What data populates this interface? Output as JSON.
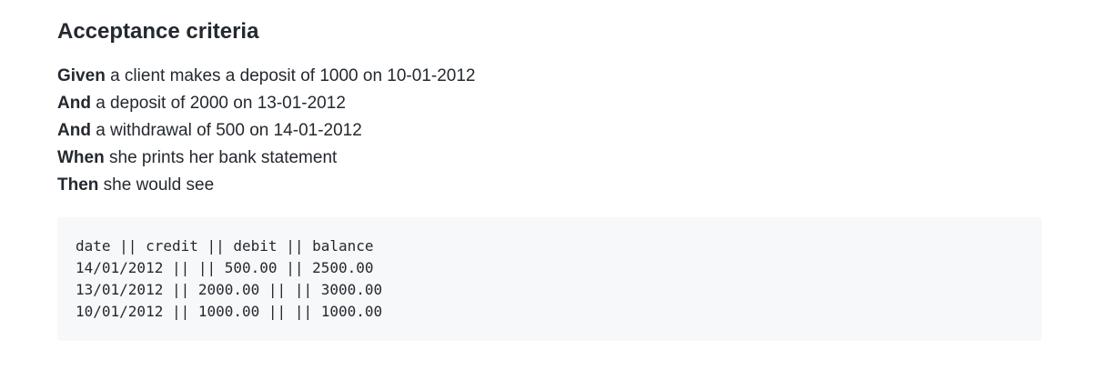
{
  "heading": "Acceptance criteria",
  "criteria": [
    {
      "keyword": "Given",
      "text": " a client makes a deposit of 1000 on 10-01-2012"
    },
    {
      "keyword": "And",
      "text": " a deposit of 2000 on 13-01-2012"
    },
    {
      "keyword": "And",
      "text": " a withdrawal of 500 on 14-01-2012"
    },
    {
      "keyword": "When",
      "text": " she prints her bank statement"
    },
    {
      "keyword": "Then",
      "text": " she would see"
    }
  ],
  "code_block": [
    "date || credit || debit || balance",
    "14/01/2012 || || 500.00 || 2500.00",
    "13/01/2012 || 2000.00 || || 3000.00",
    "10/01/2012 || 1000.00 || || 1000.00"
  ]
}
